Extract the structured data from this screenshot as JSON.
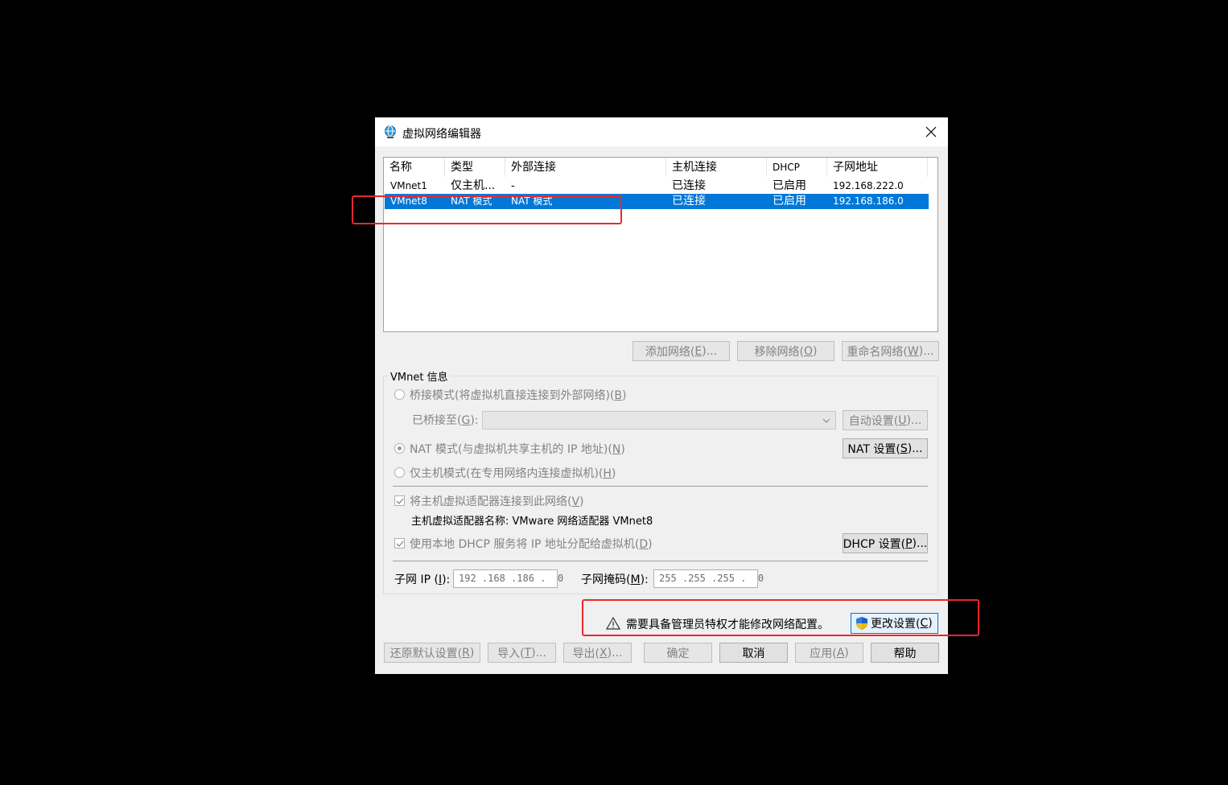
{
  "colors": {
    "selection": "#0078d7",
    "annotation": "#e8282b",
    "dialog_bg": "#f0f0f0"
  },
  "window": {
    "title": "虚拟网络编辑器",
    "icon": "network-globe-icon"
  },
  "table": {
    "headers": [
      "名称",
      "类型",
      "外部连接",
      "主机连接",
      "DHCP",
      "子网地址"
    ],
    "rows": [
      {
        "name": "VMnet1",
        "type": "仅主机...",
        "external": "-",
        "host": "已连接",
        "dhcp": "已启用",
        "subnet": "192.168.222.0",
        "selected": false
      },
      {
        "name": "VMnet8",
        "type": "NAT 模式",
        "external": "NAT 模式",
        "host": "已连接",
        "dhcp": "已启用",
        "subnet": "192.168.186.0",
        "selected": true
      }
    ]
  },
  "network_buttons": {
    "add": "添加网络(",
    "add_key": "E",
    "add_tail": ")...",
    "remove": "移除网络(",
    "remove_key": "O",
    "remove_tail": ")",
    "rename": "重命名网络(",
    "rename_key": "W",
    "rename_tail": ")..."
  },
  "vmnet_info": {
    "group_title": "VMnet 信息",
    "bridged_label": "桥接模式(将虚拟机直接连接到外部网络)(",
    "bridged_key": "B",
    "bridged_tail": ")",
    "bridged_to_label": "已桥接至(",
    "bridged_to_key": "G",
    "bridged_to_tail": "):",
    "auto_settings": "自动设置(",
    "auto_key": "U",
    "auto_tail": ")...",
    "nat_label": "NAT 模式(与虚拟机共享主机的 IP 地址)(",
    "nat_key": "N",
    "nat_tail": ")",
    "nat_settings": "NAT 设置(",
    "nat_settings_key": "S",
    "nat_settings_tail": ")...",
    "hostonly_label": "仅主机模式(在专用网络内连接虚拟机)(",
    "hostonly_key": "H",
    "hostonly_tail": ")",
    "connect_adapter_label": "将主机虚拟适配器连接到此网络(",
    "connect_adapter_key": "V",
    "connect_adapter_tail": ")",
    "adapter_name": "主机虚拟适配器名称: VMware 网络适配器 VMnet8",
    "dhcp_label": "使用本地 DHCP 服务将 IP 地址分配给虚拟机(",
    "dhcp_key": "D",
    "dhcp_tail": ")",
    "dhcp_settings": "DHCP 设置(",
    "dhcp_settings_key": "P",
    "dhcp_settings_tail": ")...",
    "subnet_ip_label": "子网 IP (",
    "subnet_ip_key": "I",
    "subnet_ip_tail": "):",
    "subnet_ip": "192 .168 .186 .  0",
    "subnet_mask_label": "子网掩码(",
    "subnet_mask_key": "M",
    "subnet_mask_tail": "):",
    "subnet_mask": "255 .255 .255 .  0"
  },
  "admin": {
    "warning": "需要具备管理员特权才能修改网络配置。",
    "change_settings": "更改设置(",
    "change_key": "C",
    "change_tail": ")"
  },
  "footer": {
    "restore": "还原默认设置(",
    "restore_key": "R",
    "restore_tail": ")",
    "import": "导入(",
    "import_key": "T",
    "import_tail": ")...",
    "export": "导出(",
    "export_key": "X",
    "export_tail": ")...",
    "ok": "确定",
    "cancel": "取消",
    "apply": "应用(",
    "apply_key": "A",
    "apply_tail": ")",
    "help": "帮助"
  }
}
